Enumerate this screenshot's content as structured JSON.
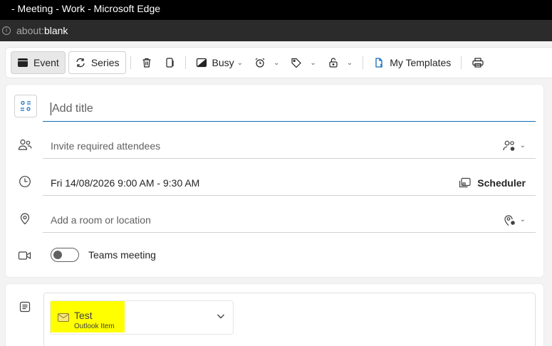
{
  "window": {
    "title": "- Meeting - Work - Microsoft Edge",
    "address_scheme": "about:",
    "address_host": "blank"
  },
  "toolbar": {
    "event_label": "Event",
    "series_label": "Series",
    "busy_label": "Busy",
    "templates_label": "My Templates"
  },
  "form": {
    "title_placeholder": "Add title",
    "attendees_placeholder": "Invite required attendees",
    "datetime": "Fri 14/08/2026 9:00 AM - 9:30 AM",
    "scheduler_label": "Scheduler",
    "location_placeholder": "Add a room or location",
    "teams_label": "Teams meeting",
    "teams_enabled": false
  },
  "body": {
    "attachment_name": "Test",
    "attachment_type": "Outlook Item",
    "highlight_color": "#ffff00"
  },
  "colors": {
    "accent": "#0f6cbd",
    "titlebar": "#000000"
  }
}
